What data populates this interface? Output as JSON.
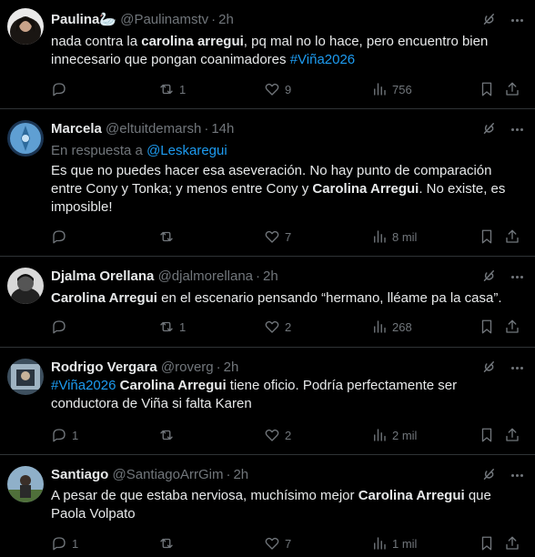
{
  "tweets": [
    {
      "name": "Paulina",
      "handle": "@Paulinamstv",
      "time": "2h",
      "name_emoji": "🦢",
      "reply_to_prefix": "",
      "reply_to_handle": "",
      "text": [
        {
          "t": "nada contra la ",
          "s": "plain"
        },
        {
          "t": "carolina arregui",
          "s": "bold"
        },
        {
          "t": ", pq mal no lo hace, pero encuentro bien innecesario que pongan coanimadores ",
          "s": "plain"
        },
        {
          "t": "#Viña2026",
          "s": "tag"
        }
      ],
      "replies": "",
      "retweets": "1",
      "likes": "9",
      "views": "756",
      "avatar_color": "#2a2522"
    },
    {
      "name": "Marcela",
      "handle": "@eltuitdemarsh",
      "time": "14h",
      "name_emoji": "",
      "reply_to_prefix": "En respuesta a",
      "reply_to_handle": "@Leskaregui",
      "text": [
        {
          "t": "Es que no puedes hacer esa aseveración. No hay punto de comparación entre Cony y Tonka; y menos entre Cony y ",
          "s": "plain"
        },
        {
          "t": "Carolina Arregui",
          "s": "bold"
        },
        {
          "t": ". No existe, es imposible!",
          "s": "plain"
        }
      ],
      "replies": "",
      "retweets": "",
      "likes": "7",
      "views": "8 mil",
      "avatar_color": "#4a7fb5"
    },
    {
      "name": "Djalma Orellana",
      "handle": "@djalmorellana",
      "time": "2h",
      "name_emoji": "",
      "reply_to_prefix": "",
      "reply_to_handle": "",
      "text": [
        {
          "t": "Carolina Arregui",
          "s": "bold"
        },
        {
          "t": " en el escenario pensando “hermano, lléame pa la casa”.",
          "s": "plain"
        }
      ],
      "replies": "",
      "retweets": "1",
      "likes": "2",
      "views": "268",
      "avatar_color": "#8a8a8a"
    },
    {
      "name": "Rodrigo Vergara",
      "handle": "@roverg",
      "time": "2h",
      "name_emoji": "",
      "reply_to_prefix": "",
      "reply_to_handle": "",
      "text": [
        {
          "t": "#Viña2026",
          "s": "tag"
        },
        {
          "t": " ",
          "s": "plain"
        },
        {
          "t": "Carolina Arregui",
          "s": "bold"
        },
        {
          "t": " tiene oficio. Podría perfectamente ser conductora de Viña si falta Karen",
          "s": "plain"
        }
      ],
      "replies": "1",
      "retweets": "",
      "likes": "2",
      "views": "2 mil",
      "avatar_color": "#6d7c88"
    },
    {
      "name": "Santiago",
      "handle": "@SantiagoArrGim",
      "time": "2h",
      "name_emoji": "",
      "reply_to_prefix": "",
      "reply_to_handle": "",
      "text": [
        {
          "t": "A pesar de que estaba nerviosa, muchísimo mejor ",
          "s": "plain"
        },
        {
          "t": "Carolina Arregui",
          "s": "bold"
        },
        {
          "t": " que Paola Volpato",
          "s": "plain"
        }
      ],
      "replies": "1",
      "retweets": "",
      "likes": "7",
      "views": "1 mil",
      "avatar_color": "#6b8aa5"
    }
  ]
}
